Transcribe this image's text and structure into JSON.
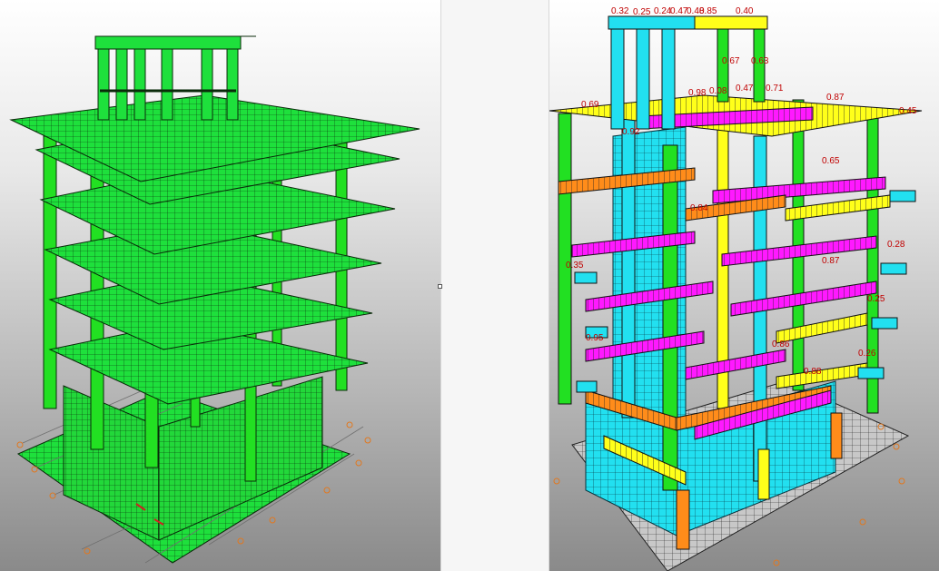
{
  "colors": {
    "model_green": "#1ee03c",
    "mesh_line": "#0a2a0a",
    "beam_orange": "#ff8c1a",
    "beam_magenta": "#ff19ff",
    "beam_yellow": "#ffff1a",
    "beam_cyan": "#22f0ff",
    "column_green": "#22e022",
    "label_red": "#c00000",
    "axis_orange": "#e07820"
  },
  "right_view": {
    "labels": [
      "0.32",
      "0.25",
      "0.24",
      "0.47",
      "0.48",
      "0.85",
      "0.40",
      "0.69",
      "0.67",
      "0.63",
      "0.98",
      "0.08",
      "0.47",
      "0.71",
      "0.87",
      "0.45",
      "0.92",
      "0.65",
      "0.84",
      "0.35",
      "0.87",
      "0.95",
      "0.25",
      "0.86",
      "0.88",
      "0.26",
      "0.28"
    ]
  }
}
